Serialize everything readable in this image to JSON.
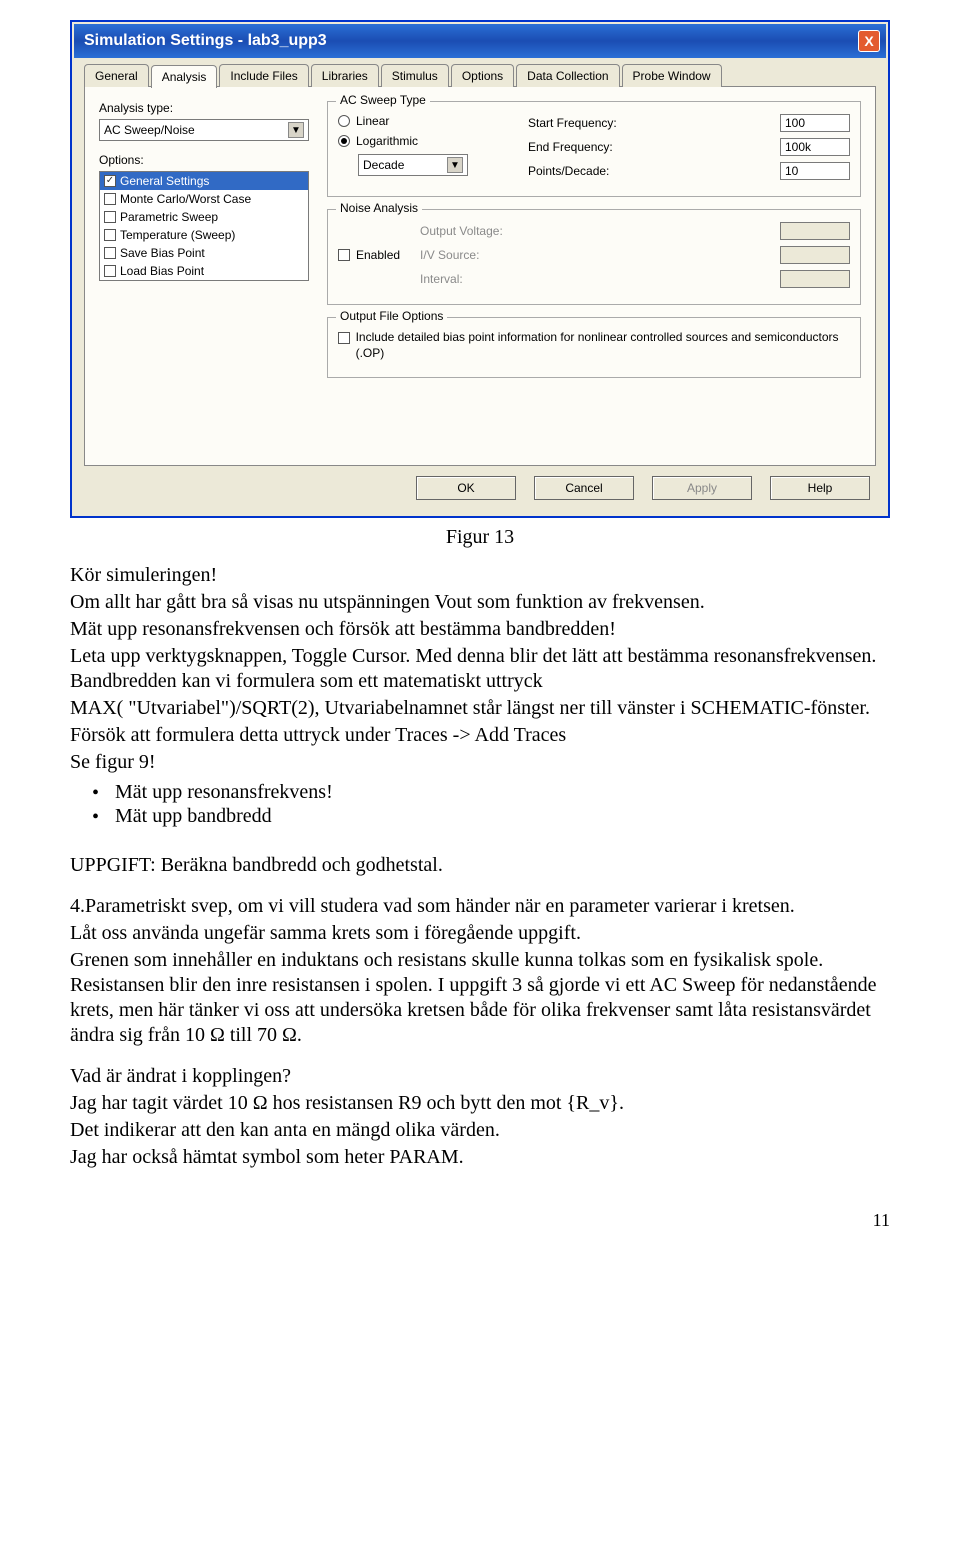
{
  "dialog": {
    "title": "Simulation Settings - lab3_upp3",
    "close_label": "X",
    "tabs": [
      "General",
      "Analysis",
      "Include Files",
      "Libraries",
      "Stimulus",
      "Options",
      "Data Collection",
      "Probe Window"
    ],
    "active_tab_index": 1,
    "analysis_type_label": "Analysis type:",
    "analysis_type_value": "AC Sweep/Noise",
    "options_label": "Options:",
    "options_items": [
      {
        "label": "General Settings",
        "checked": true,
        "selected": true
      },
      {
        "label": "Monte Carlo/Worst Case",
        "checked": false,
        "selected": false
      },
      {
        "label": "Parametric Sweep",
        "checked": false,
        "selected": false
      },
      {
        "label": "Temperature (Sweep)",
        "checked": false,
        "selected": false
      },
      {
        "label": "Save Bias Point",
        "checked": false,
        "selected": false
      },
      {
        "label": "Load Bias Point",
        "checked": false,
        "selected": false
      }
    ],
    "ac_sweep": {
      "legend": "AC Sweep Type",
      "linear": "Linear",
      "logarithmic": "Logarithmic",
      "scale_value": "Decade",
      "start_label": "Start Frequency:",
      "start_value": "100",
      "end_label": "End Frequency:",
      "end_value": "100k",
      "ppd_label": "Points/Decade:",
      "ppd_value": "10"
    },
    "noise": {
      "legend": "Noise Analysis",
      "enabled": "Enabled",
      "ov": "Output Voltage:",
      "iv": "I/V Source:",
      "interval": "Interval:"
    },
    "ofo": {
      "legend": "Output File Options",
      "text": "Include detailed bias point information for nonlinear controlled sources and semiconductors (.OP)"
    },
    "buttons": {
      "ok": "OK",
      "cancel": "Cancel",
      "apply": "Apply",
      "help": "Help"
    }
  },
  "caption": "Figur 13",
  "doc": {
    "p1": "Kör simuleringen!",
    "p2": "Om allt har gått bra så visas nu utspänningen Vout  som funktion av frekvensen.",
    "p3": "Mät upp resonansfrekvensen och försök att bestämma bandbredden!",
    "p4": "Leta upp verktygsknappen, Toggle Cursor. Med denna blir det lätt att bestämma resonansfrekvensen. Bandbredden kan vi formulera som ett matematiskt uttryck",
    "p5": "MAX( \"Utvariabel\")/SQRT(2), Utvariabelnamnet står längst ner till vänster i SCHEMATIC-fönster.",
    "p6": "Försök att formulera detta uttryck under Traces -> Add Traces",
    "p7": "Se figur 9!",
    "b1": "Mät upp resonansfrekvens!",
    "b2": "Mät upp bandbredd",
    "upp": "UPPGIFT: Beräkna bandbredd och godhetstal.",
    "s4a": "4.Parametriskt svep, om vi vill studera vad som händer när en parameter varierar i kretsen.",
    "s4b": "Låt oss använda ungefär samma krets som i föregående uppgift.",
    "s4c": "Grenen som innehåller en induktans och resistans skulle kunna tolkas som en fysikalisk spole. Resistansen blir den inre resistansen i spolen. I uppgift 3 så gjorde vi ett AC Sweep för nedanstående krets, men här tänker vi oss att undersöka kretsen både för olika frekvenser samt låta resistansvärdet ändra sig från 10 Ω till 70 Ω.",
    "q": "Vad är ändrat i kopplingen?",
    "a1": "Jag har tagit värdet 10 Ω hos resistansen R9  och bytt den mot {R_v}.",
    "a2": "Det indikerar att den kan anta en mängd olika värden.",
    "a3": "Jag har också hämtat symbol som heter PARAM.",
    "page": "11"
  }
}
